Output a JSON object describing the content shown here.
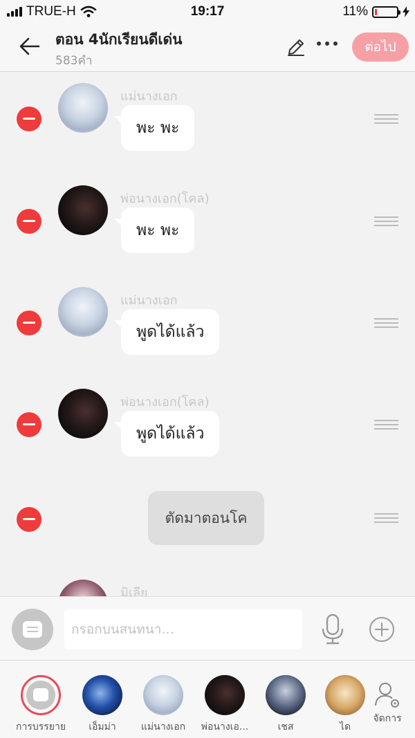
{
  "status_bar": {
    "carrier": "TRUE-H",
    "time": "19:17",
    "battery_percent_text": "11%",
    "battery_level": 0.11
  },
  "header": {
    "title": "ตอน 4นักเรียนดีเด่น",
    "subtitle": "583คำ",
    "next_label": "ต่อไป",
    "icons": [
      "back-arrow-icon",
      "pencil-icon",
      "more-icon"
    ]
  },
  "messages": [
    {
      "type": "dialogue",
      "sender": "แม่นางเอก",
      "text": "พะ พะ",
      "avatar": "light"
    },
    {
      "type": "dialogue",
      "sender": "พ่อนางเอก(โคล)",
      "text": "พะ พะ",
      "avatar": "dark"
    },
    {
      "type": "dialogue",
      "sender": "แม่นางเอก",
      "text": "พูดได้แล้ว",
      "avatar": "light"
    },
    {
      "type": "dialogue",
      "sender": "พ่อนางเอก(โคล)",
      "text": "พูดได้แล้ว",
      "avatar": "dark"
    },
    {
      "type": "narration",
      "text": "ตัดมาตอนโค"
    },
    {
      "type": "dialogue",
      "sender": "มิเลีย",
      "text": "",
      "avatar": "mia"
    }
  ],
  "input_bar": {
    "placeholder": "กรอกบนสนทนา..."
  },
  "characters": [
    {
      "label": "การบรรยาย",
      "selected": true,
      "style": "selected"
    },
    {
      "label": "เอ็มม่า",
      "selected": false,
      "style": "emma"
    },
    {
      "label": "แม่นางเอก",
      "selected": false,
      "style": "light"
    },
    {
      "label": "พ่อนางเอ...",
      "selected": false,
      "style": "dark"
    },
    {
      "label": "เชส",
      "selected": false,
      "style": "ches"
    },
    {
      "label": "ได",
      "selected": false,
      "style": "dai"
    }
  ],
  "manage_label": "จัดการ",
  "colors": {
    "delete_red": "#ef3b3b",
    "accent_pink": "#f6a0a6",
    "selected_ring": "#e94b58"
  }
}
